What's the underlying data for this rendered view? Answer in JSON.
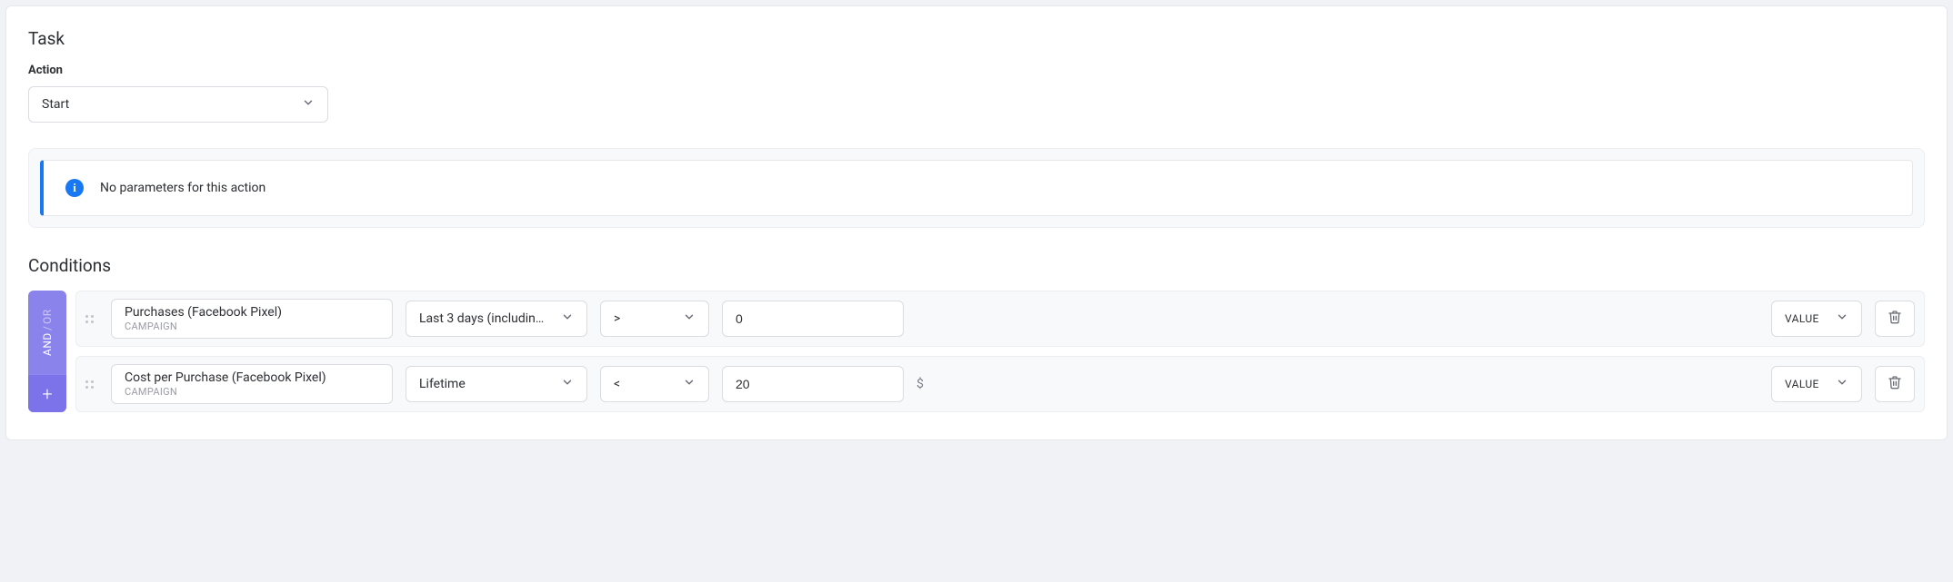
{
  "task": {
    "title": "Task",
    "action_label": "Action",
    "action_value": "Start",
    "info_message": "No parameters for this action"
  },
  "conditions": {
    "title": "Conditions",
    "sidebar": {
      "and_label": "AND",
      "or_label": "OR",
      "add_label": "+"
    },
    "value_type_label": "VALUE",
    "rows": [
      {
        "metric_name": "Purchases (Facebook Pixel)",
        "metric_level": "CAMPAIGN",
        "period": "Last 3 days (includin…",
        "operator": ">",
        "value": "0",
        "unit": ""
      },
      {
        "metric_name": "Cost per Purchase (Facebook Pixel)",
        "metric_level": "CAMPAIGN",
        "period": "Lifetime",
        "operator": "<",
        "value": "20",
        "unit": "$"
      }
    ]
  }
}
